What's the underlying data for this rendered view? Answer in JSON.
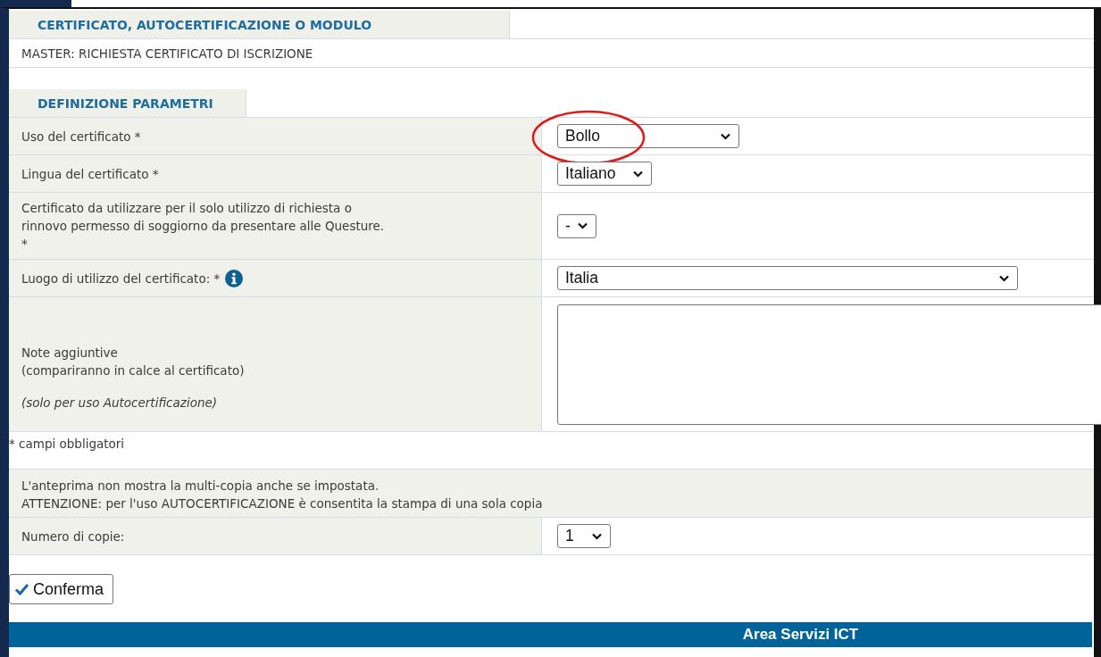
{
  "header_tab": "CERTIFICATO, AUTOCERTIFICAZIONE O MODULO",
  "subject": "MASTER: RICHIESTA CERTIFICATO DI ISCRIZIONE",
  "params_tab": "DEFINIZIONE PARAMETRI",
  "fields": [
    {
      "kind": "select",
      "label": "Uso del certificato *",
      "value": "Bollo",
      "circled": true,
      "info": false
    },
    {
      "kind": "select",
      "label": "Lingua del certificato *",
      "value": "Italiano",
      "circled": false,
      "info": false
    },
    {
      "kind": "select",
      "label": "Certificato da utilizzare per il solo utilizzo di richiesta o\nrinnovo permesso di soggiorno da presentare alle Questure.\n*",
      "value": "-",
      "circled": false,
      "info": false
    },
    {
      "kind": "select",
      "label": "Luogo di utilizzo del certificato: *",
      "value": "Italia",
      "circled": false,
      "info": true
    },
    {
      "kind": "textarea",
      "label": "Note aggiuntive\n(compariranno in calce al certificato)",
      "note": "(solo per uso Autocertificazione)",
      "circled": false,
      "info": false
    }
  ],
  "required_note": "* campi obbligatori",
  "notice": "L'anteprima non mostra la multi-copia anche se impostata.\nATTENZIONE: per l'uso AUTOCERTIFICAZIONE è consentita la stampa di una sola copia",
  "copies": {
    "label": "Numero di copie:",
    "value": "1"
  },
  "confirm_button": "Conferma",
  "footer": "Area Servizi ICT"
}
